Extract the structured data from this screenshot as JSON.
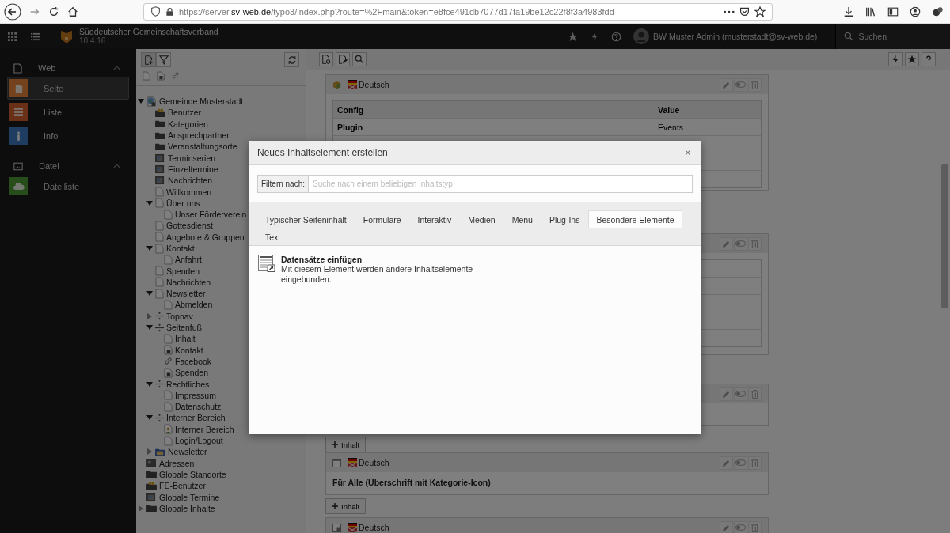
{
  "browser": {
    "url": {
      "start": "https://server.",
      "domain": "sv-web.de",
      "path": "/typo3/index.php?route=%2Fmain&token=e8fce491db7077d17fa19be12c22f8f3a4983fdd"
    }
  },
  "topbar": {
    "site_name": "Süddeutscher Gemeinschaftsverband",
    "version": "10.4.16",
    "user": "BW Muster Admin (musterstadt@sv-web.de)",
    "search": "Suchen"
  },
  "modules": [
    {
      "label": "Web",
      "kind": "page",
      "expanded": true,
      "items": [
        {
          "label": "Seite",
          "kind": "page",
          "selected": true
        },
        {
          "label": "Liste",
          "kind": "list",
          "selected": false
        },
        {
          "label": "Info",
          "kind": "info",
          "selected": false
        }
      ]
    },
    {
      "label": "Datei",
      "kind": "image",
      "expanded": true,
      "items": [
        {
          "label": "Dateiliste",
          "kind": "cloud",
          "selected": false
        }
      ]
    }
  ],
  "page_tree": {
    "items": [
      {
        "label": "Gemeinde Musterstadt",
        "kind": "site",
        "expanded": true,
        "children": [
          {
            "label": "Benutzer",
            "kind": "users-folder"
          },
          {
            "label": "Kategorien",
            "kind": "folder"
          },
          {
            "label": "Ansprechpartner",
            "kind": "folder"
          },
          {
            "label": "Veranstaltungsorte",
            "kind": "folder"
          },
          {
            "label": "Terminserien",
            "kind": "events-folder"
          },
          {
            "label": "Einzeltermine",
            "kind": "events-folder"
          },
          {
            "label": "Nachrichten",
            "kind": "events-folder"
          },
          {
            "label": "Willkommen",
            "kind": "page"
          },
          {
            "label": "Über uns",
            "kind": "page",
            "expanded": true,
            "children": [
              {
                "label": "Unser Förderverein",
                "kind": "page"
              }
            ]
          },
          {
            "label": "Gottesdienst",
            "kind": "page"
          },
          {
            "label": "Angebote & Gruppen",
            "kind": "page"
          },
          {
            "label": "Kontakt",
            "kind": "page",
            "expanded": true,
            "children": [
              {
                "label": "Anfahrt",
                "kind": "page"
              }
            ]
          },
          {
            "label": "Spenden",
            "kind": "page"
          },
          {
            "label": "Nachrichten",
            "kind": "page"
          },
          {
            "label": "Newsletter",
            "kind": "page",
            "expanded": true,
            "children": [
              {
                "label": "Abmelden",
                "kind": "page"
              }
            ]
          },
          {
            "label": "Topnav",
            "kind": "spacer",
            "expanded": false
          },
          {
            "label": "Seitenfuß",
            "kind": "spacer",
            "expanded": true,
            "children": [
              {
                "label": "Inhalt",
                "kind": "page"
              },
              {
                "label": "Kontakt",
                "kind": "shortcut"
              },
              {
                "label": "Facebook",
                "kind": "link"
              },
              {
                "label": "Spenden",
                "kind": "shortcut"
              }
            ]
          },
          {
            "label": "Rechtliches",
            "kind": "spacer",
            "expanded": true,
            "children": [
              {
                "label": "Impressum",
                "kind": "page"
              },
              {
                "label": "Datenschutz",
                "kind": "page"
              }
            ]
          },
          {
            "label": "Interner Bereich",
            "kind": "spacer",
            "expanded": true,
            "children": [
              {
                "label": "Interner Bereich",
                "kind": "user-page"
              },
              {
                "label": "Login/Logout",
                "kind": "page"
              }
            ]
          },
          {
            "label": "Newsletter",
            "kind": "newsletter-folder",
            "expanded": false
          }
        ]
      },
      {
        "label": "Adressen",
        "kind": "address-folder"
      },
      {
        "label": "Globale Standorte",
        "kind": "folder"
      },
      {
        "label": "FE-Benutzer",
        "kind": "users-folder"
      },
      {
        "label": "Globale Termine",
        "kind": "events-folder"
      },
      {
        "label": "Globale Inhalte",
        "kind": "folder",
        "expanded": false
      }
    ]
  },
  "content": {
    "cards": [
      {
        "kind": "table",
        "language": "Deutsch",
        "columns": [
          "Config",
          "Value"
        ],
        "rows": [
          [
            "Plugin",
            "Events"
          ]
        ]
      },
      {
        "kind": "covered-table"
      },
      {
        "kind": "covered",
        "add_button": "Inhalt"
      },
      {
        "kind": "text",
        "language": "Deutsch",
        "header": "Für Alle (Überschrift mit Kategorie-Icon)",
        "add_button": "Inhalt"
      },
      {
        "kind": "cut",
        "language": "Deutsch"
      }
    ]
  },
  "modal": {
    "title": "Neues Inhaltselement erstellen",
    "close": "×",
    "filter_label": "Filtern nach:",
    "placeholder": "Suche nach einem beliebigen Inhaltstyp",
    "tabs": [
      {
        "label": "Typischer Seiteninhalt",
        "selected": false
      },
      {
        "label": "Formulare",
        "selected": false
      },
      {
        "label": "Interaktiv",
        "selected": false
      },
      {
        "label": "Medien",
        "selected": false
      },
      {
        "label": "Menü",
        "selected": false
      },
      {
        "label": "Plug-Ins",
        "selected": false
      },
      {
        "label": "Besondere Elemente",
        "selected": true
      },
      {
        "label": "Text",
        "selected": false
      }
    ],
    "elements": [
      {
        "title": "Datensätze einfügen",
        "description": "Mit diesem Element werden andere Inhaltselemente eingebunden."
      }
    ]
  }
}
